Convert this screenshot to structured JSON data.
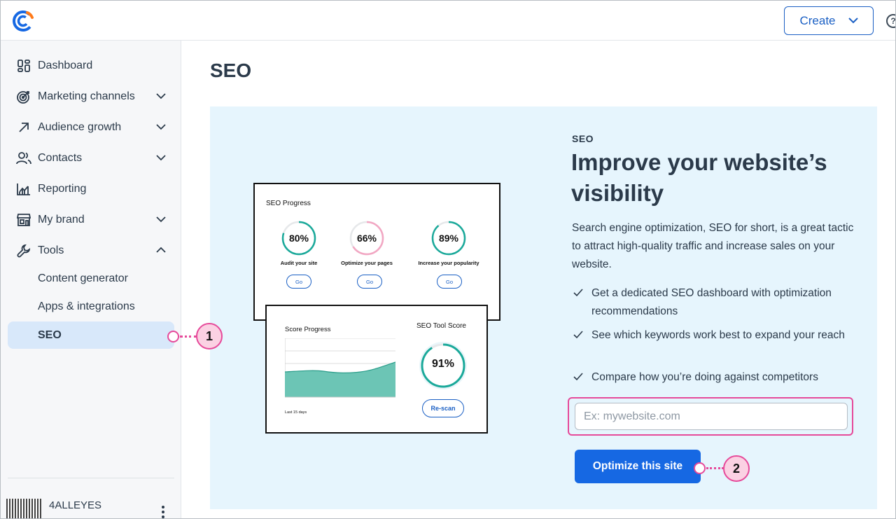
{
  "header": {
    "create_label": "Create",
    "help_label": "?"
  },
  "sidebar": {
    "items": [
      {
        "label": "Dashboard",
        "icon": "dashboard-icon",
        "expandable": false
      },
      {
        "label": "Marketing channels",
        "icon": "target-icon",
        "expandable": true
      },
      {
        "label": "Audience growth",
        "icon": "arrow-up-right-icon",
        "expandable": true
      },
      {
        "label": "Contacts",
        "icon": "contacts-icon",
        "expandable": true
      },
      {
        "label": "Reporting",
        "icon": "chart-icon",
        "expandable": false
      },
      {
        "label": "My brand",
        "icon": "store-icon",
        "expandable": true
      },
      {
        "label": "Tools",
        "icon": "wrench-icon",
        "expandable": true,
        "expanded": true
      }
    ],
    "sub_items": [
      "Content generator",
      "Apps & integrations",
      "SEO"
    ],
    "active_sub_item": "SEO",
    "account_name": "4ALLEYES"
  },
  "main": {
    "page_title": "SEO",
    "illustration": {
      "progress_title": "SEO Progress",
      "metrics": [
        {
          "value": "80%",
          "label": "Audit your site",
          "button": "Go",
          "fraction": 0.8,
          "color": "#1aa99a"
        },
        {
          "value": "66%",
          "label": "Optimize your pages",
          "button": "Go",
          "fraction": 0.66,
          "color": "#f2a7c3"
        },
        {
          "value": "89%",
          "label": "Increase your popularity",
          "button": "Go",
          "fraction": 0.89,
          "color": "#1aa99a"
        }
      ],
      "score_progress_title": "Score Progress",
      "score_footer": "Last 15 days",
      "tool_score_title": "SEO Tool Score",
      "tool_score_value": "91%",
      "tool_score_fraction": 0.91,
      "rescan_label": "Re-scan"
    },
    "eyebrow": "SEO",
    "headline": "Improve your website’s visibility",
    "description": "Search engine optimization, SEO for short, is a great tactic to attract high-quality traffic and increase sales on your website.",
    "bullets": [
      "Get a dedicated SEO dashboard with optimization recommendations",
      "See which keywords work best to expand your reach",
      "Compare how you’re doing against competitors"
    ],
    "url_placeholder": "Ex: mywebsite.com",
    "optimize_label": "Optimize this site"
  },
  "callouts": [
    "1",
    "2"
  ],
  "colors": {
    "accent": "#1668e3",
    "card_bg": "#e6f5fd",
    "callout": "#e64a9a",
    "teal": "#1aa99a"
  }
}
